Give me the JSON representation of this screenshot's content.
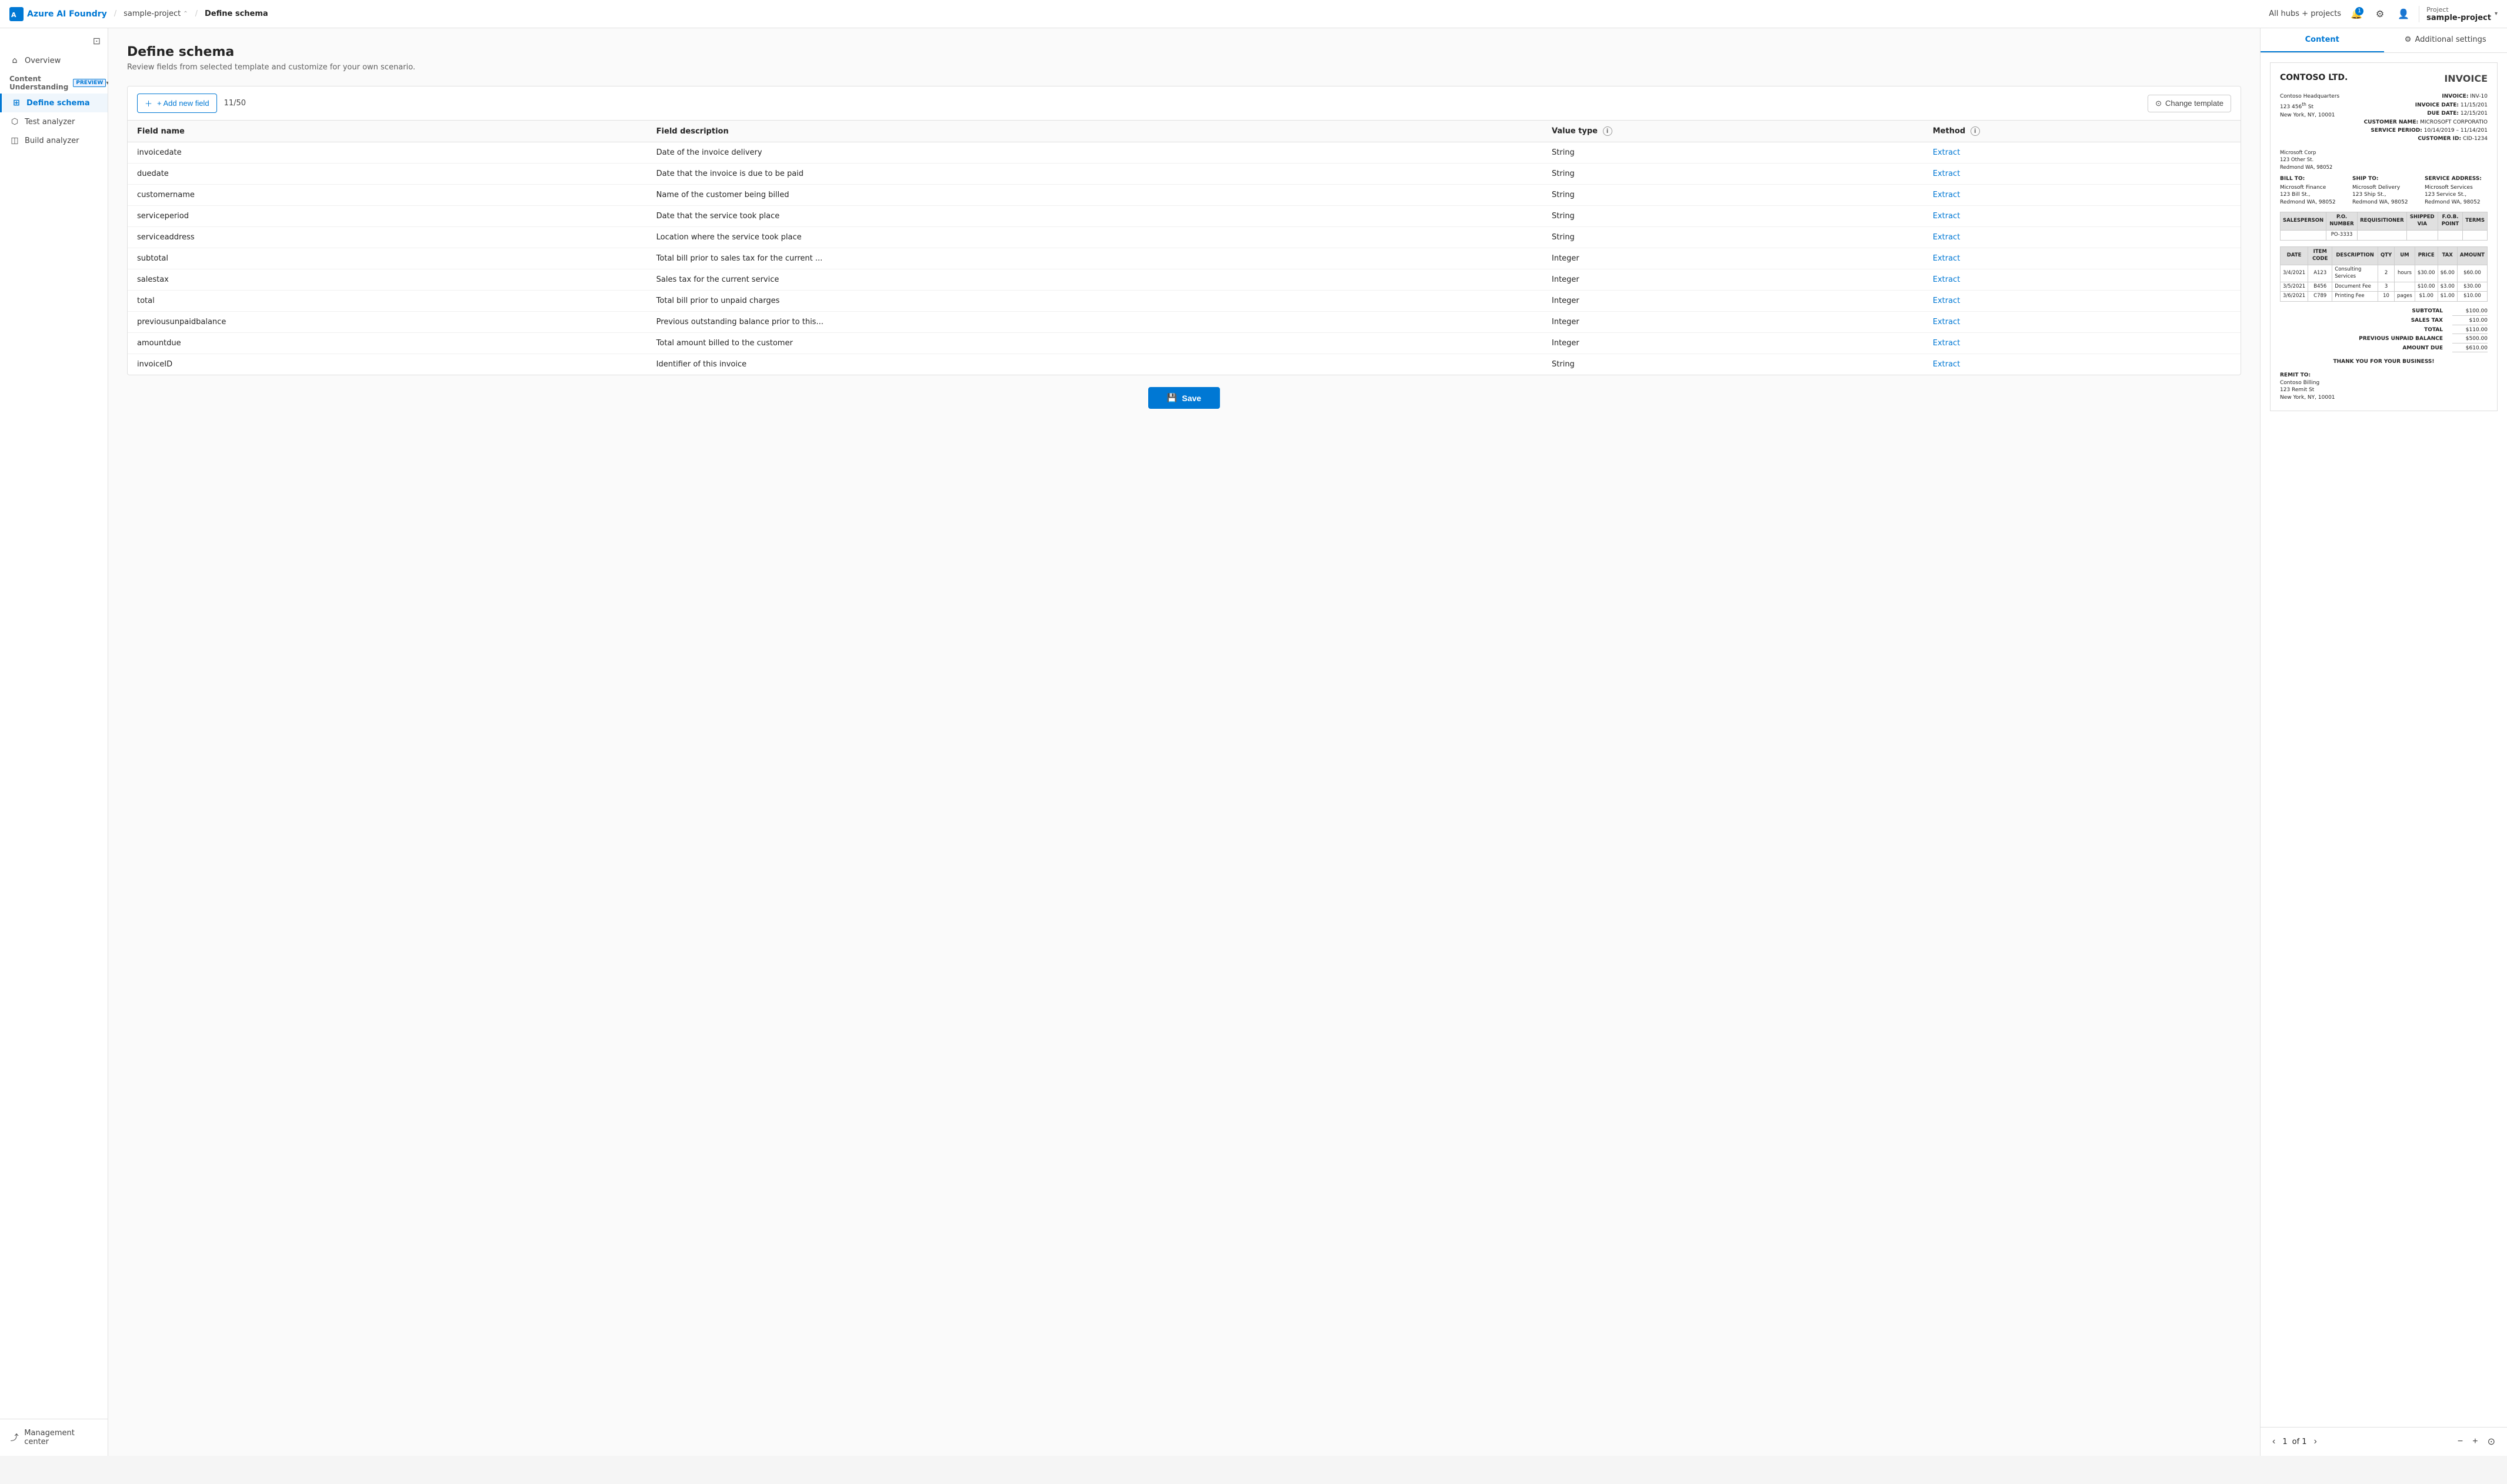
{
  "topnav": {
    "brand": "Azure AI Foundry",
    "crumb1": "sample-project",
    "crumb2": "Define schema",
    "hubs_label": "All hubs + projects",
    "notif_count": "1",
    "project_label": "Project",
    "project_name": "sample-project"
  },
  "sidebar": {
    "collapse_icon": "⊡",
    "overview_label": "Overview",
    "section_label": "Content Understanding",
    "preview_badge": "PREVIEW",
    "items": [
      {
        "id": "define-schema",
        "label": "Define schema",
        "active": true
      },
      {
        "id": "test-analyzer",
        "label": "Test analyzer",
        "active": false
      },
      {
        "id": "build-analyzer",
        "label": "Build analyzer",
        "active": false
      }
    ],
    "bottom": {
      "label": "Management center"
    }
  },
  "page": {
    "title": "Define schema",
    "subtitle": "Review fields from selected template and customize for your own scenario."
  },
  "toolbar": {
    "add_field_label": "+ Add new field",
    "field_count": "11/50",
    "change_template_label": "Change template"
  },
  "table": {
    "headers": [
      "Field name",
      "Field description",
      "Value type",
      "Method"
    ],
    "rows": [
      {
        "name": "invoicedate",
        "description": "Date of the invoice delivery",
        "value_type": "String",
        "method": "Extract"
      },
      {
        "name": "duedate",
        "description": "Date that the invoice is due to be paid",
        "value_type": "String",
        "method": "Extract"
      },
      {
        "name": "customername",
        "description": "Name of the customer being billed",
        "value_type": "String",
        "method": "Extract"
      },
      {
        "name": "serviceperiod",
        "description": "Date that the service took place",
        "value_type": "String",
        "method": "Extract"
      },
      {
        "name": "serviceaddress",
        "description": "Location where the service took place",
        "value_type": "String",
        "method": "Extract"
      },
      {
        "name": "subtotal",
        "description": "Total bill prior to sales tax for the current ...",
        "value_type": "Integer",
        "method": "Extract"
      },
      {
        "name": "salestax",
        "description": "Sales tax for the current service",
        "value_type": "Integer",
        "method": "Extract"
      },
      {
        "name": "total",
        "description": "Total bill prior to unpaid charges",
        "value_type": "Integer",
        "method": "Extract"
      },
      {
        "name": "previousunpaidbalance",
        "description": "Previous outstanding balance prior to this...",
        "value_type": "Integer",
        "method": "Extract"
      },
      {
        "name": "amountdue",
        "description": "Total amount billed to the customer",
        "value_type": "Integer",
        "method": "Extract"
      },
      {
        "name": "invoiceID",
        "description": "Identifier of this invoice",
        "value_type": "String",
        "method": "Extract"
      }
    ]
  },
  "save_button": "Save",
  "right_panel": {
    "tabs": [
      "Content",
      "Additional settings"
    ],
    "active_tab": "Content",
    "page_info": "1",
    "of_label": "of 1"
  },
  "invoice": {
    "company": "CONTOSO LTD.",
    "title": "INVOICE",
    "address": "Contoso Headquarters\n123 456th St\nNew York, NY, 10001",
    "invoice_num_label": "INVOICE:",
    "invoice_num": "INV-10",
    "invoice_date_label": "INVOICE DATE:",
    "invoice_date": "11/15/201",
    "due_date_label": "DUE DATE:",
    "due_date": "12/15/201",
    "customer_label": "CUSTOMER NAME:",
    "customer": "MICROSOFT CORPORATIO",
    "service_period_label": "SERVICE PERIOD:",
    "service_period": "10/14/2019 – 11/14/201",
    "customer_id_label": "CUSTOMER ID:",
    "customer_id": "CID-1234",
    "bill_to": "Microsoft Corp\n123 Other St.\nRedmond WA, 98052",
    "ship_to": "Microsoft Delivery\n123 Ship St.\nRedmond WA, 98052",
    "service_address": "Microsoft Services\n123 Service St.\nRedmond WA, 98052",
    "line_items": [
      {
        "date": "3/4/2021",
        "code": "A123",
        "description": "Consulting Services",
        "qty": "2",
        "um": "hours",
        "price": "$30.00",
        "tax": "$6.00",
        "amount": "$60.00"
      },
      {
        "date": "3/5/2021",
        "code": "B456",
        "description": "Document Fee",
        "qty": "3",
        "um": "",
        "price": "$10.00",
        "tax": "$3.00",
        "amount": "$30.00"
      },
      {
        "date": "3/6/2021",
        "code": "C789",
        "description": "Printing Fee",
        "qty": "10",
        "um": "pages",
        "price": "$1.00",
        "tax": "$1.00",
        "amount": "$10.00"
      }
    ],
    "subtotal_label": "SUBTOTAL",
    "subtotal_val": "$100.00",
    "sales_tax_label": "SALES TAX",
    "sales_tax_val": "$10.00",
    "total_label": "TOTAL",
    "total_val": "$110.00",
    "prev_balance_label": "PREVIOUS UNPAID BALANCE",
    "prev_balance_val": "$500.00",
    "amount_due_label": "AMOUNT DUE",
    "amount_due_val": "$610.00",
    "thank_you": "THANK YOU FOR YOUR BUSINESS!",
    "remit_label": "REMIT TO:",
    "remit": "Contoso Billing\n123 Remit St\nNew York, NY, 10001"
  }
}
